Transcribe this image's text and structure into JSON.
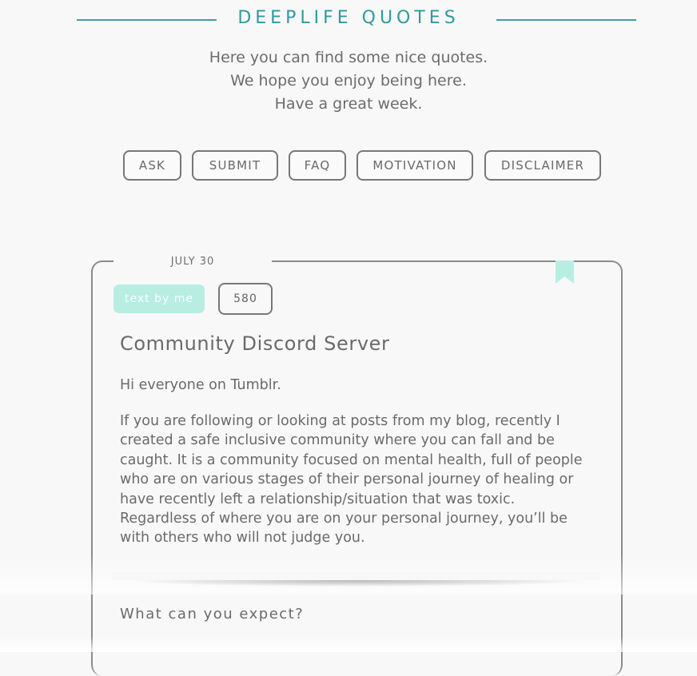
{
  "header": {
    "title": "DEEPLIFE QUOTES",
    "tagline": [
      "Here you can find some nice quotes.",
      "We hope you enjoy being here.",
      "Have a great week."
    ]
  },
  "nav": {
    "items": [
      "ASK",
      "SUBMIT",
      "FAQ",
      "MOTIVATION",
      "DISCLAIMER"
    ]
  },
  "post": {
    "date": "JULY 30",
    "tag": "text by me",
    "notes": "580",
    "title": "Community Discord Server",
    "intro": "Hi everyone on Tumblr.",
    "body_lines": [
      "If you are following or looking at posts from my blog, recently I",
      "created a safe inclusive community where you can fall and be",
      "caught. It is a community focused on mental health, full of people",
      "who are on various stages of their personal journey of healing or",
      "have recently left a relationship/situation that was toxic.",
      "Regardless of where you are on your personal journey, you’ll be",
      "with others who will not judge you."
    ],
    "subheading": "What can you expect?",
    "bookmark_icon": "bookmark-icon"
  },
  "colors": {
    "accent": "#2f9a9c",
    "tag_bg": "#b8eee2",
    "border": "#777777",
    "background": "#f8f8f9"
  }
}
